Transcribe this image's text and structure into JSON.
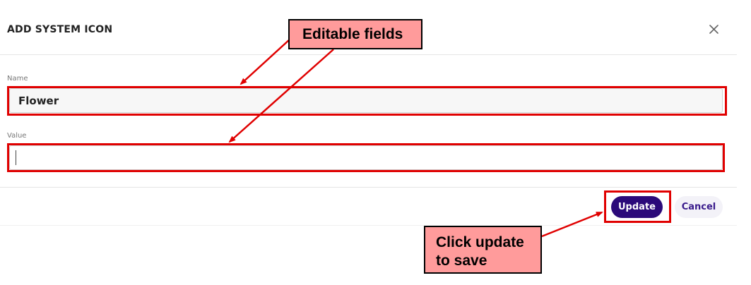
{
  "dialog": {
    "title": "ADD SYSTEM ICON",
    "close_icon": "close-icon"
  },
  "fields": {
    "name": {
      "label": "Name",
      "value": "Flower"
    },
    "value": {
      "label": "Value",
      "value": ""
    }
  },
  "footer": {
    "update_label": "Update",
    "cancel_label": "Cancel"
  },
  "annotations": {
    "editable_fields": "Editable fields",
    "click_update_line1": "Click update",
    "click_update_line2": "to save",
    "highlight_color": "#e00000",
    "callout_fill": "#ff9b9b"
  },
  "colors": {
    "primary_button": "#2b0a7a",
    "cancel_text": "#3a1c8c"
  }
}
